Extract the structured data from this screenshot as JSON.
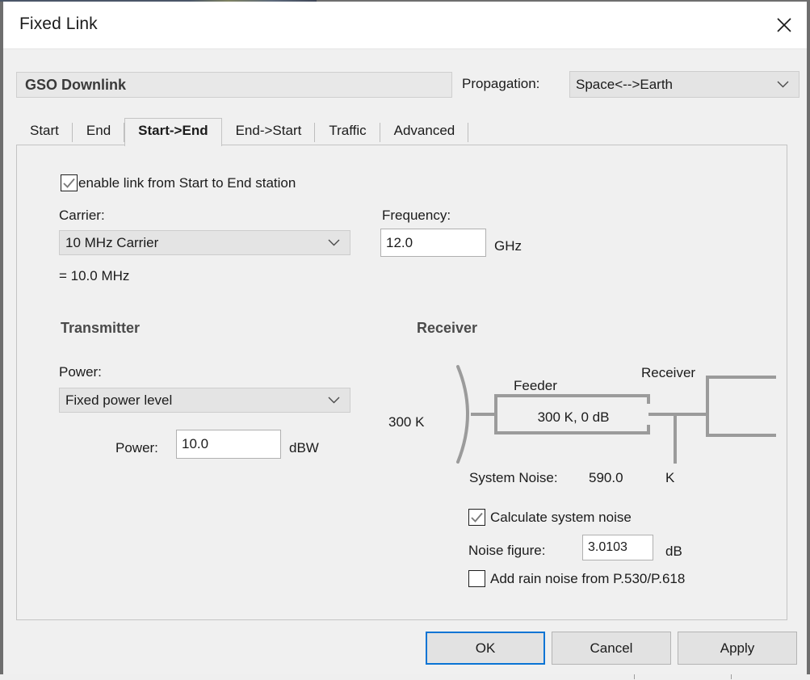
{
  "window": {
    "title": "Fixed Link",
    "close_icon": "close-icon"
  },
  "header": {
    "link_name": "GSO Downlink",
    "propagation_label": "Propagation:",
    "propagation_value": "Space<-->Earth",
    "dropdown_icon": "chevron-down-icon"
  },
  "tabs": [
    {
      "label": "Start",
      "active": false
    },
    {
      "label": "End",
      "active": false
    },
    {
      "label": "Start->End",
      "active": true
    },
    {
      "label": "End->Start",
      "active": false
    },
    {
      "label": "Traffic",
      "active": false
    },
    {
      "label": "Advanced",
      "active": false
    }
  ],
  "form": {
    "enable_link_label": "enable link from Start to End station",
    "enable_link_checked": true,
    "carrier_label": "Carrier:",
    "carrier_value": "10 MHz Carrier",
    "carrier_equals": "= 10.0 MHz",
    "frequency_label": "Frequency:",
    "frequency_value": "12.0",
    "frequency_unit": "GHz"
  },
  "transmitter": {
    "heading": "Transmitter",
    "power_mode_label": "Power:",
    "power_mode_value": "Fixed power level",
    "power_value_label": "Power:",
    "power_value": "10.0",
    "power_unit": "dBW"
  },
  "receiver": {
    "heading": "Receiver",
    "antenna_temperature": "300 K",
    "feeder_label": "Feeder",
    "feeder_value": "300 K, 0 dB",
    "receiver_box_label": "Receiver",
    "system_noise_label": "System Noise:",
    "system_noise_value": "590.0",
    "system_noise_unit": "K",
    "calculate_system_noise_label": "Calculate system noise",
    "calculate_system_noise_checked": true,
    "noise_figure_label": "Noise figure:",
    "noise_figure_value": "3.0103",
    "noise_figure_unit": "dB",
    "add_rain_noise_label": "Add rain noise from P.530/P.618",
    "add_rain_noise_checked": false
  },
  "footer": {
    "ok": "OK",
    "cancel": "Cancel",
    "apply": "Apply"
  },
  "colors": {
    "focus_blue": "#0a74d4",
    "dialog_bg": "#f0f0f0",
    "diagram_gray": "#9b9b9b",
    "heading_gray": "#4a4a4a"
  }
}
